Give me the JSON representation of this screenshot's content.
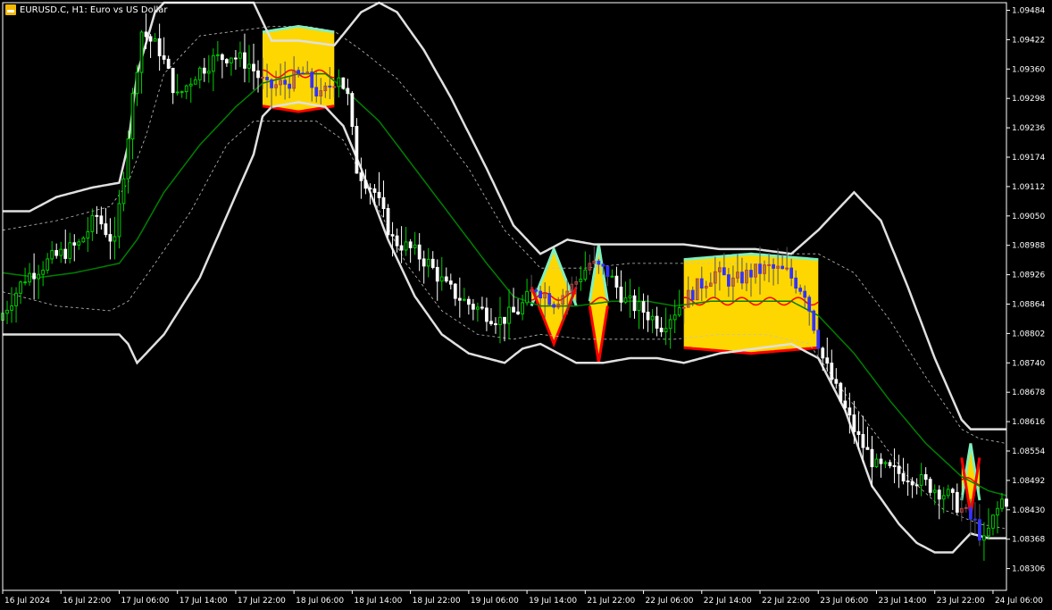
{
  "window": {
    "title": "EURUSD.C, H1:  Euro vs US Dollar",
    "icon": "symbol-icon"
  },
  "colors": {
    "background": "#000000",
    "candle_up": "#00cc00",
    "candle_up_body": "#000000",
    "candle_down": "#ffffff",
    "candle_highlight_down": "#3333ff",
    "upper_band": "#e0e0e0",
    "lower_band": "#e0e0e0",
    "inner_band": "#bfbfbf",
    "middle_band": "#008000",
    "zone_fill": "#ffd700",
    "zone_top_edge": "#80f0c0",
    "zone_bottom_edge": "#ff0000",
    "zone_mid": "#ff0000",
    "axis": "#ffffff"
  },
  "chart_data": {
    "type": "candlestick",
    "symbol": "EURUSD.C",
    "timeframe": "H1",
    "description": "Euro vs US Dollar",
    "ylim": [
      1.0826,
      1.095
    ],
    "y_ticks": [
      "1.09484",
      "1.09422",
      "1.09360",
      "1.09298",
      "1.09236",
      "1.09174",
      "1.09112",
      "1.09050",
      "1.08988",
      "1.08926",
      "1.08864",
      "1.08802",
      "1.08740",
      "1.08678",
      "1.08616",
      "1.08554",
      "1.08492",
      "1.08430",
      "1.08368",
      "1.08306"
    ],
    "x_ticks": [
      "16 Jul 2024",
      "16 Jul 22:00",
      "17 Jul 06:00",
      "17 Jul 14:00",
      "17 Jul 22:00",
      "18 Jul 06:00",
      "18 Jul 14:00",
      "18 Jul 22:00",
      "19 Jul 06:00",
      "19 Jul 14:00",
      "21 Jul 22:00",
      "22 Jul 06:00",
      "22 Jul 14:00",
      "22 Jul 22:00",
      "23 Jul 06:00",
      "23 Jul 14:00",
      "23 Jul 22:00",
      "24 Jul 06:00"
    ],
    "price_path": [
      [
        0,
        1.0883
      ],
      [
        6,
        1.0892
      ],
      [
        12,
        1.0896
      ],
      [
        18,
        1.0899
      ],
      [
        22,
        1.0905
      ],
      [
        26,
        1.0899
      ],
      [
        30,
        1.093
      ],
      [
        32,
        1.0944
      ],
      [
        36,
        1.094
      ],
      [
        40,
        1.093
      ],
      [
        44,
        1.0935
      ],
      [
        48,
        1.0938
      ],
      [
        52,
        1.0939
      ],
      [
        56,
        1.0937
      ],
      [
        60,
        1.0932
      ],
      [
        64,
        1.0933
      ],
      [
        68,
        1.0935
      ],
      [
        72,
        1.093
      ],
      [
        76,
        1.0935
      ],
      [
        78,
        1.093
      ],
      [
        80,
        1.0915
      ],
      [
        84,
        1.091
      ],
      [
        88,
        1.09
      ],
      [
        92,
        1.0898
      ],
      [
        96,
        1.0895
      ],
      [
        100,
        1.089
      ],
      [
        104,
        1.0887
      ],
      [
        108,
        1.0885
      ],
      [
        112,
        1.0883
      ],
      [
        116,
        1.0885
      ],
      [
        120,
        1.089
      ],
      [
        124,
        1.0887
      ],
      [
        128,
        1.089
      ],
      [
        132,
        1.0895
      ],
      [
        136,
        1.0893
      ],
      [
        140,
        1.0887
      ],
      [
        144,
        1.0885
      ],
      [
        148,
        1.0882
      ],
      [
        152,
        1.0886
      ],
      [
        156,
        1.089
      ],
      [
        160,
        1.0893
      ],
      [
        164,
        1.0891
      ],
      [
        168,
        1.0893
      ],
      [
        172,
        1.0894
      ],
      [
        176,
        1.0893
      ],
      [
        180,
        1.0889
      ],
      [
        184,
        1.0875
      ],
      [
        188,
        1.0866
      ],
      [
        192,
        1.0858
      ],
      [
        196,
        1.0852
      ],
      [
        200,
        1.0851
      ],
      [
        204,
        1.085
      ],
      [
        208,
        1.0848
      ],
      [
        212,
        1.0846
      ],
      [
        216,
        1.0842
      ],
      [
        218,
        1.084
      ],
      [
        220,
        1.0836
      ],
      [
        222,
        1.0841
      ],
      [
        224,
        1.0845
      ]
    ],
    "bands": {
      "upper": [
        [
          0,
          1.0906
        ],
        [
          6,
          1.0906
        ],
        [
          12,
          1.0909
        ],
        [
          20,
          1.0911
        ],
        [
          26,
          1.0912
        ],
        [
          28,
          1.092
        ],
        [
          30,
          1.0935
        ],
        [
          34,
          1.0948
        ],
        [
          36,
          1.095
        ],
        [
          48,
          1.095
        ],
        [
          56,
          1.095
        ],
        [
          60,
          1.0942
        ],
        [
          66,
          1.0942
        ],
        [
          74,
          1.0941
        ],
        [
          80,
          1.0948
        ],
        [
          84,
          1.095
        ],
        [
          88,
          1.0948
        ],
        [
          94,
          1.094
        ],
        [
          100,
          1.093
        ],
        [
          108,
          1.0915
        ],
        [
          114,
          1.0903
        ],
        [
          120,
          1.0897
        ],
        [
          126,
          1.09
        ],
        [
          132,
          1.0899
        ],
        [
          138,
          1.0899
        ],
        [
          146,
          1.0899
        ],
        [
          152,
          1.0899
        ],
        [
          160,
          1.0898
        ],
        [
          168,
          1.0898
        ],
        [
          176,
          1.0897
        ],
        [
          182,
          1.0902
        ],
        [
          190,
          1.091
        ],
        [
          196,
          1.0904
        ],
        [
          202,
          1.089
        ],
        [
          208,
          1.0875
        ],
        [
          214,
          1.0862
        ],
        [
          216,
          1.086
        ],
        [
          224,
          1.086
        ]
      ],
      "lower": [
        [
          0,
          1.088
        ],
        [
          8,
          1.088
        ],
        [
          20,
          1.088
        ],
        [
          26,
          1.088
        ],
        [
          28,
          1.0878
        ],
        [
          30,
          1.0874
        ],
        [
          32,
          1.0876
        ],
        [
          36,
          1.088
        ],
        [
          44,
          1.0892
        ],
        [
          50,
          1.0905
        ],
        [
          56,
          1.0918
        ],
        [
          58,
          1.0926
        ],
        [
          60,
          1.0928
        ],
        [
          66,
          1.0929
        ],
        [
          72,
          1.0928
        ],
        [
          76,
          1.0924
        ],
        [
          80,
          1.0915
        ],
        [
          86,
          1.09
        ],
        [
          92,
          1.0888
        ],
        [
          98,
          1.088
        ],
        [
          104,
          1.0876
        ],
        [
          108,
          1.0875
        ],
        [
          112,
          1.0874
        ],
        [
          116,
          1.0877
        ],
        [
          120,
          1.0878
        ],
        [
          124,
          1.0876
        ],
        [
          128,
          1.0874
        ],
        [
          134,
          1.0874
        ],
        [
          140,
          1.0875
        ],
        [
          146,
          1.0875
        ],
        [
          152,
          1.0874
        ],
        [
          160,
          1.0876
        ],
        [
          168,
          1.0877
        ],
        [
          176,
          1.0878
        ],
        [
          182,
          1.0875
        ],
        [
          188,
          1.0864
        ],
        [
          194,
          1.0848
        ],
        [
          200,
          1.084
        ],
        [
          204,
          1.0836
        ],
        [
          208,
          1.0834
        ],
        [
          212,
          1.0834
        ],
        [
          216,
          1.0838
        ],
        [
          220,
          1.0837
        ],
        [
          224,
          1.0837
        ]
      ],
      "inner_upper": [
        [
          0,
          1.0902
        ],
        [
          12,
          1.0904
        ],
        [
          24,
          1.0907
        ],
        [
          28,
          1.0912
        ],
        [
          32,
          1.0922
        ],
        [
          36,
          1.0935
        ],
        [
          44,
          1.0943
        ],
        [
          52,
          1.0944
        ],
        [
          60,
          1.0945
        ],
        [
          68,
          1.0945
        ],
        [
          74,
          1.0944
        ],
        [
          80,
          1.094
        ],
        [
          88,
          1.0934
        ],
        [
          96,
          1.0925
        ],
        [
          104,
          1.0915
        ],
        [
          112,
          1.0902
        ],
        [
          120,
          1.0894
        ],
        [
          130,
          1.0894
        ],
        [
          140,
          1.0895
        ],
        [
          150,
          1.0895
        ],
        [
          160,
          1.0895
        ],
        [
          170,
          1.0895
        ],
        [
          176,
          1.0897
        ],
        [
          182,
          1.0897
        ],
        [
          190,
          1.0893
        ],
        [
          198,
          1.0883
        ],
        [
          206,
          1.0871
        ],
        [
          214,
          1.086
        ],
        [
          218,
          1.0858
        ],
        [
          224,
          1.0857
        ]
      ],
      "inner_lower": [
        [
          0,
          1.0889
        ],
        [
          12,
          1.0886
        ],
        [
          24,
          1.0885
        ],
        [
          28,
          1.0887
        ],
        [
          34,
          1.0895
        ],
        [
          42,
          1.0906
        ],
        [
          50,
          1.092
        ],
        [
          56,
          1.0925
        ],
        [
          62,
          1.0925
        ],
        [
          70,
          1.0925
        ],
        [
          76,
          1.0921
        ],
        [
          82,
          1.091
        ],
        [
          90,
          1.0895
        ],
        [
          98,
          1.0885
        ],
        [
          106,
          1.088
        ],
        [
          114,
          1.0879
        ],
        [
          120,
          1.088
        ],
        [
          130,
          1.0879
        ],
        [
          140,
          1.0879
        ],
        [
          150,
          1.0879
        ],
        [
          160,
          1.088
        ],
        [
          170,
          1.088
        ],
        [
          180,
          1.0878
        ],
        [
          186,
          1.087
        ],
        [
          194,
          1.086
        ],
        [
          202,
          1.085
        ],
        [
          210,
          1.0843
        ],
        [
          218,
          1.084
        ],
        [
          224,
          1.0839
        ]
      ],
      "middle": [
        [
          0,
          1.0893
        ],
        [
          8,
          1.0892
        ],
        [
          16,
          1.0893
        ],
        [
          26,
          1.0895
        ],
        [
          30,
          1.09
        ],
        [
          36,
          1.091
        ],
        [
          44,
          1.092
        ],
        [
          52,
          1.0928
        ],
        [
          58,
          1.0933
        ],
        [
          66,
          1.0935
        ],
        [
          72,
          1.0935
        ],
        [
          76,
          1.0932
        ],
        [
          84,
          1.0925
        ],
        [
          92,
          1.0915
        ],
        [
          100,
          1.0905
        ],
        [
          108,
          1.0895
        ],
        [
          114,
          1.0888
        ],
        [
          120,
          1.0886
        ],
        [
          128,
          1.0886
        ],
        [
          136,
          1.0887
        ],
        [
          144,
          1.0887
        ],
        [
          150,
          1.0886
        ],
        [
          158,
          1.0887
        ],
        [
          166,
          1.0887
        ],
        [
          176,
          1.0887
        ],
        [
          182,
          1.0884
        ],
        [
          190,
          1.0876
        ],
        [
          198,
          1.0866
        ],
        [
          206,
          1.0857
        ],
        [
          214,
          1.085
        ],
        [
          220,
          1.0847
        ],
        [
          224,
          1.0846
        ]
      ]
    },
    "zones": [
      {
        "x_start": 58,
        "x_end": 74,
        "top": 1.0945,
        "bottom": 1.0927,
        "mid": 1.0935
      },
      {
        "x_start": 118,
        "x_end": 128,
        "top": 1.0898,
        "bottom": 1.0878,
        "mid": 1.0888
      },
      {
        "x_start": 131,
        "x_end": 135,
        "top": 1.0899,
        "bottom": 1.0874,
        "mid": 1.0887
      },
      {
        "x_start": 152,
        "x_end": 182,
        "top": 1.0897,
        "bottom": 1.0876,
        "mid": 1.0887
      },
      {
        "x_start": 214,
        "x_end": 218,
        "top": 1.0857,
        "bottom": 1.0842,
        "mid": 1.0849
      }
    ],
    "x_max": 224
  }
}
